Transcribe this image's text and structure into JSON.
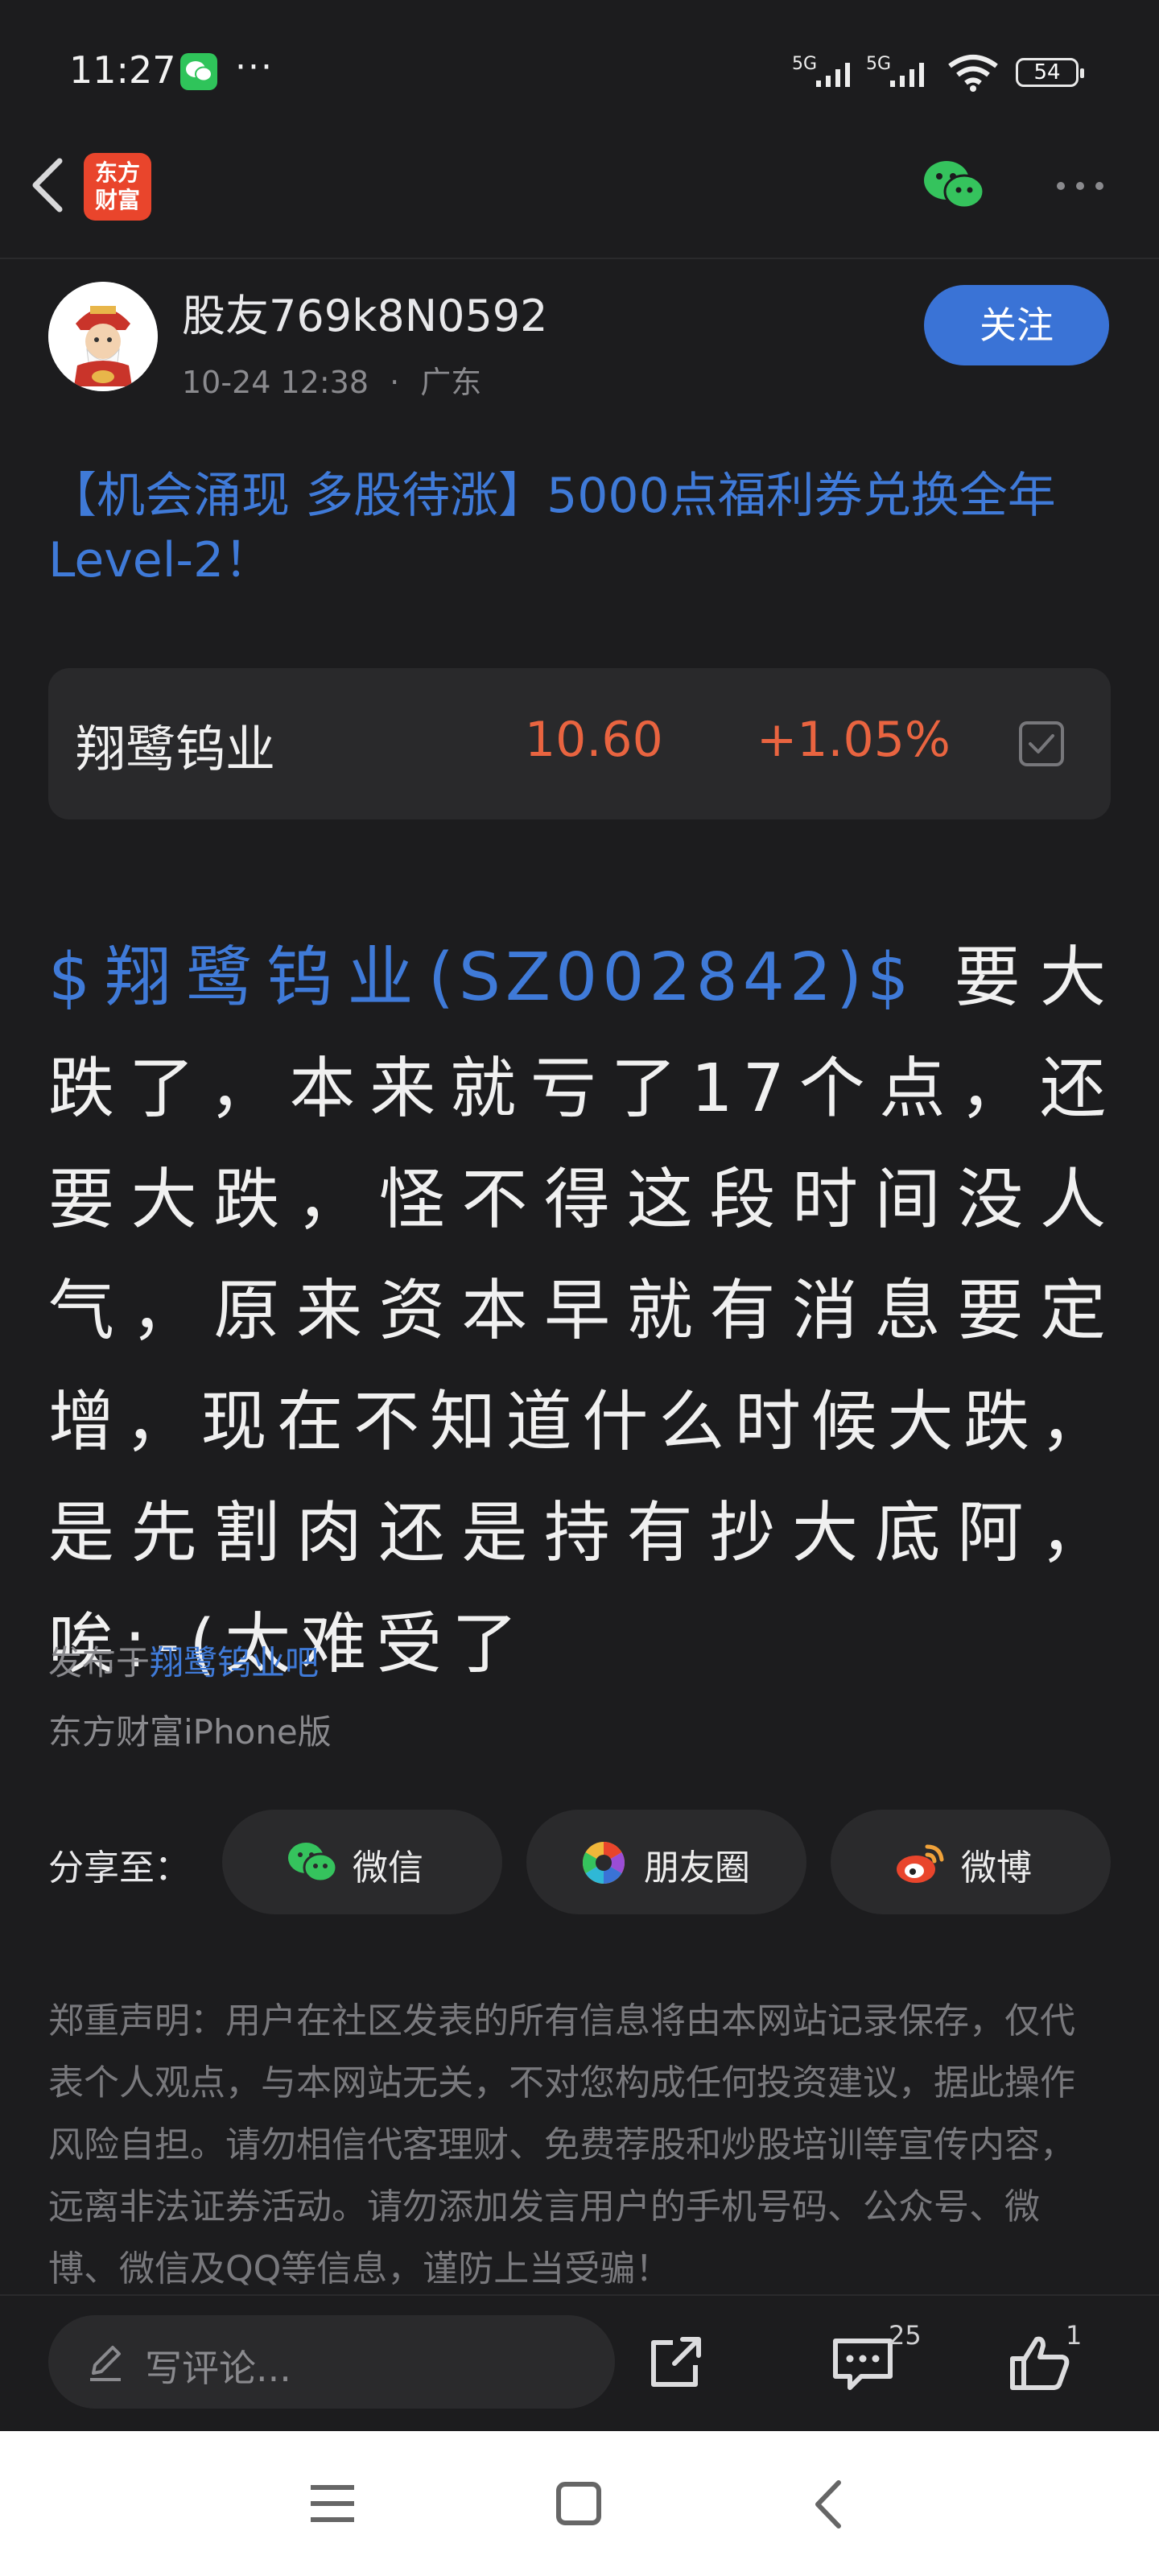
{
  "status_bar": {
    "time": "11:27",
    "battery": "54",
    "network_1": "5G",
    "network_2": "5G"
  },
  "nav": {
    "logo_line1": "东方",
    "logo_line2": "财富"
  },
  "author": {
    "name": "股友769k8N0592",
    "timestamp": "10-24 12:38",
    "separator": "·",
    "location": "广东",
    "follow_label": "关注"
  },
  "promo_link": "【机会涌现 多股待涨】5000点福利券兑换全年Level-2！",
  "stock": {
    "name": "翔鹭钨业",
    "price": "10.60",
    "change": "+1.05%"
  },
  "post": {
    "tag": "$翔鹭钨业(SZ002842)$",
    "text": " 要大跌了，本来就亏了17个点，还要大跌，怪不得这段时间没人气，原来资本早就有消息要定增，现在不知道什么时候大跌，是先割肉还是持有抄大底阿，唉:-(太难受了"
  },
  "publish": {
    "prefix": "发布于",
    "board": "翔鹭钨业吧",
    "client": "东方财富iPhone版"
  },
  "share": {
    "label": "分享至：",
    "wechat": "微信",
    "moments": "朋友圈",
    "weibo": "微博"
  },
  "disclaimer": "郑重声明：用户在社区发表的所有信息将由本网站记录保存，仅代表个人观点，与本网站无关，不对您构成任何投资建议，据此操作风险自担。请勿相信代客理财、免费荐股和炒股培训等宣传内容，远离非法证券活动。请勿添加发言用户的手机号码、公众号、微博、微信及QQ等信息，谨防上当受骗！",
  "bottom_bar": {
    "comment_placeholder": "写评论...",
    "comment_count": "25",
    "like_count": "1"
  },
  "colors": {
    "accent_blue": "#3f7ad8",
    "price_red": "#e96440",
    "background": "#1c1c1e"
  }
}
